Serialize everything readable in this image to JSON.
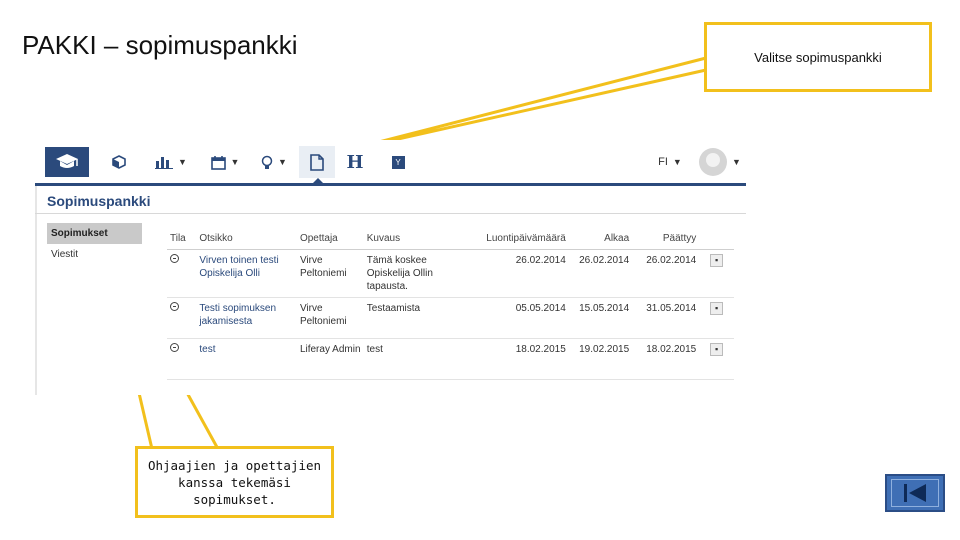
{
  "slide": {
    "title": "PAKKI – sopimuspankki",
    "callout_top": "Valitse sopimuspankki",
    "callout_bottom": "Ohjaajien ja opettajien kanssa tekemäsi sopimukset.",
    "accent_color": "#f2c01c"
  },
  "app": {
    "brand_color": "#2b4a7c",
    "toolbar": {
      "icons": [
        "graduation-cap-icon",
        "cube-icon",
        "bar-chart-icon",
        "calendar-icon",
        "lightbulb-icon",
        "document-icon",
        "h-icon",
        "y-icon"
      ],
      "h_label": "H",
      "y_label": "Y",
      "language": "FI"
    },
    "portlet_title": "Sopimuspankki",
    "nav": {
      "active": "Sopimukset",
      "items": [
        "Sopimukset",
        "Viestit"
      ]
    },
    "table": {
      "headers": {
        "status": "Tila",
        "title": "Otsikko",
        "teacher": "Opettaja",
        "description": "Kuvaus",
        "created": "Luontipäivämäärä",
        "start": "Alkaa",
        "end": "Päättyy"
      },
      "rows": [
        {
          "title": "Virven toinen testi Opiskelija Olli",
          "teacher": "Virve Peltoniemi",
          "description": "Tämä koskee Opiskelija Ollin tapausta.",
          "created": "26.02.2014",
          "start": "26.02.2014",
          "end": "26.02.2014"
        },
        {
          "title": "Testi sopimuksen jakamisesta",
          "teacher": "Virve Peltoniemi",
          "description": "Testaamista",
          "created": "05.05.2014",
          "start": "15.05.2014",
          "end": "31.05.2014"
        },
        {
          "title": "test",
          "teacher": "Liferay Admin",
          "description": "test",
          "created": "18.02.2015",
          "start": "19.02.2015",
          "end": "18.02.2015"
        }
      ]
    }
  }
}
